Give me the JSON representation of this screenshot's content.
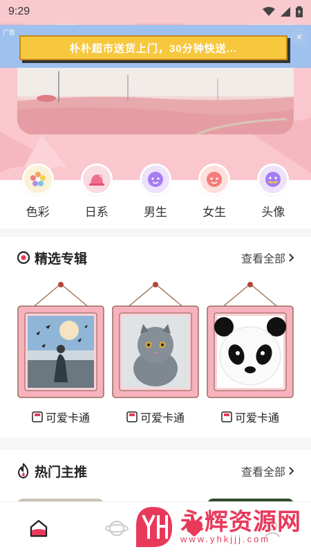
{
  "status_bar": {
    "time": "9:29"
  },
  "ad": {
    "label": "广告",
    "text": "朴朴超市送货上门，30分钟快送...",
    "close": "×"
  },
  "categories": [
    {
      "label": "色彩",
      "icon": "flower-icon",
      "bg": "#fbf1d6"
    },
    {
      "label": "日系",
      "icon": "hat-icon",
      "bg": "#fbdbe3"
    },
    {
      "label": "男生",
      "icon": "boy-face-icon",
      "bg": "#ede2fb"
    },
    {
      "label": "女生",
      "icon": "girl-face-icon",
      "bg": "#fde0dc"
    },
    {
      "label": "头像",
      "icon": "mustache-face-icon",
      "bg": "#ede2fb"
    }
  ],
  "featured": {
    "title": "精选专辑",
    "more": "查看全部",
    "albums": [
      {
        "label": "可爱卡通",
        "photo": "child-with-birds"
      },
      {
        "label": "可爱卡通",
        "photo": "grey-kitten"
      },
      {
        "label": "可爱卡通",
        "photo": "panda-face"
      }
    ]
  },
  "hot": {
    "title": "热门主推",
    "more": "查看全部"
  },
  "bottom_nav": [
    {
      "icon": "home-icon",
      "active": true
    },
    {
      "icon": "planet-icon",
      "active": false
    },
    {
      "icon": "heart-icon",
      "active": false
    },
    {
      "icon": "profile-icon",
      "active": false
    }
  ],
  "watermark": {
    "text": "永辉资源网",
    "url": "www.yhkjjj.com"
  },
  "colors": {
    "header_pink": "#f9c7cd",
    "frame_pink": "#f6b3bd",
    "accent_red": "#e8395b"
  }
}
